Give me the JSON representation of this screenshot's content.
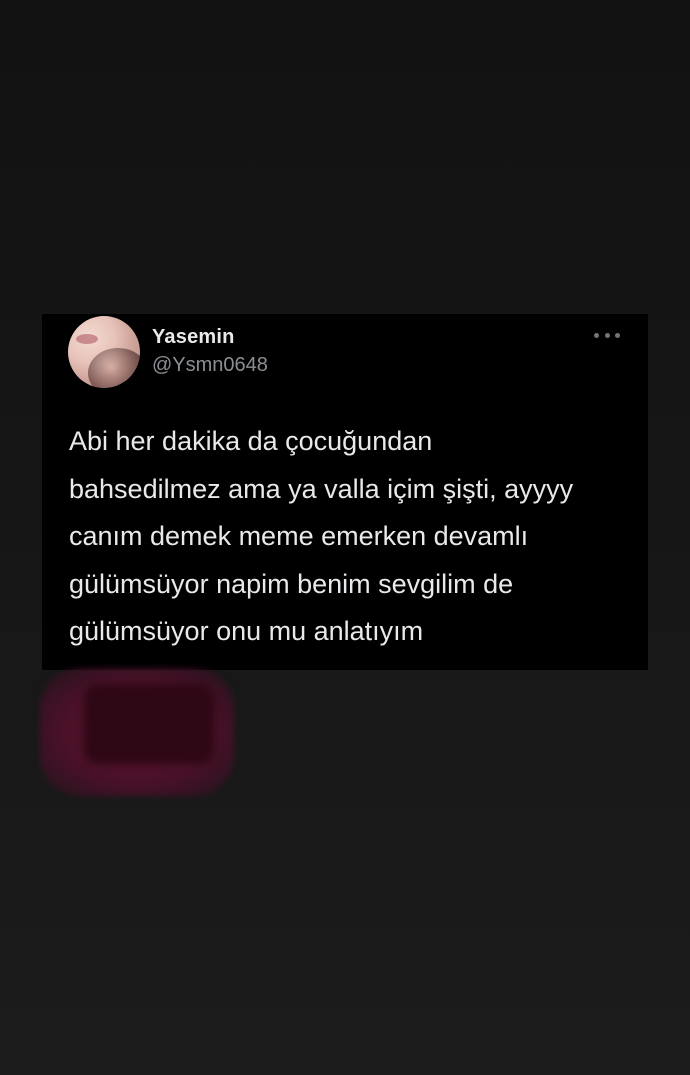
{
  "tweet": {
    "display_name": "Yasemin",
    "handle": "@Ysmn0648",
    "text": "Abi her dakika da çocuğundan\nbahsedilmez ama ya valla içim şişti, ayyyy\ncanım demek meme emerken devamlı\ngülümsüyor napim benim sevgilim de\ngülümsüyor onu mu anlatıyım",
    "more_icon": "more-horizontal-icon"
  },
  "colors": {
    "background": "#161616",
    "card": "#000000",
    "primary_text": "#e7e9ea",
    "secondary_text": "#8b8f94",
    "redaction": "#4a1128"
  }
}
